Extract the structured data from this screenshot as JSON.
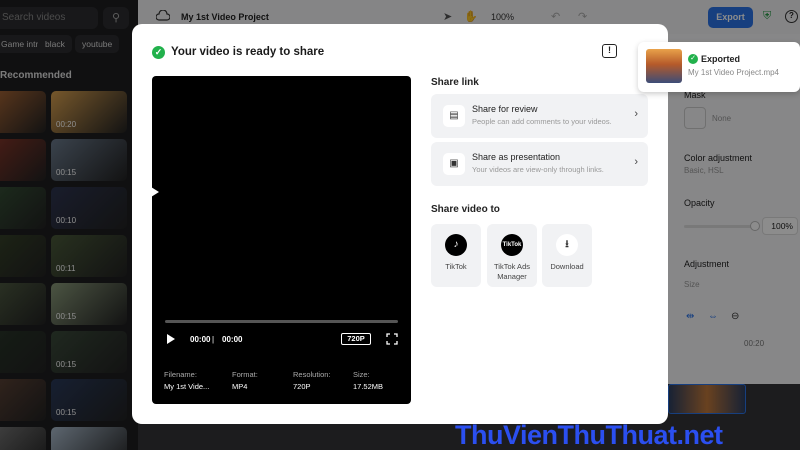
{
  "library": {
    "search_placeholder": "Search videos",
    "chips": [
      "Game intro",
      "black",
      "youtube"
    ],
    "section_title": "Recommended",
    "thumbs": [
      {
        "duration": "",
        "color": "#c8763a"
      },
      {
        "duration": "00:20",
        "color": "#d8a050"
      },
      {
        "duration": "",
        "color": "#9a3a2a"
      },
      {
        "duration": "00:15",
        "color": "#6b7a8c"
      },
      {
        "duration": "",
        "color": "#3a5a3a"
      },
      {
        "duration": "00:10",
        "color": "#2e3550"
      },
      {
        "duration": "",
        "color": "#3b4a2a"
      },
      {
        "duration": "00:11",
        "color": "#4a5a3a"
      },
      {
        "duration": "",
        "color": "#5a6a4a"
      },
      {
        "duration": "00:15",
        "color": "#8a9a7a"
      },
      {
        "duration": "",
        "color": "#2a3a2a"
      },
      {
        "duration": "00:15",
        "color": "#3a4a3a"
      },
      {
        "duration": "",
        "color": "#6a4a3a"
      },
      {
        "duration": "00:15",
        "color": "#2a3a5a"
      },
      {
        "duration": "",
        "color": "#8a8a8a"
      },
      {
        "duration": "",
        "color": "#aabbcc"
      }
    ]
  },
  "topbar": {
    "project_title": "My 1st Video Project",
    "zoom": "100%",
    "export_label": "Export"
  },
  "inspector": {
    "mask_label": "Mask",
    "none_label": "None",
    "color_adj_label": "Color adjustment",
    "color_adj_sub": "Basic, HSL",
    "opacity_label": "Opacity",
    "opacity_value": "100%",
    "adjustment_label": "Adjustment",
    "size_label": "Size"
  },
  "timeline": {
    "time_marker": "00:20"
  },
  "modal": {
    "title": "Your video is ready to share",
    "player": {
      "current_time": "00:00",
      "total_time": "00:00",
      "progress": 0,
      "resolution_badge": "720P"
    },
    "meta": [
      {
        "label": "Filename:",
        "value": "My 1st Vide..."
      },
      {
        "label": "Format:",
        "value": "MP4"
      },
      {
        "label": "Resolution:",
        "value": "720P"
      },
      {
        "label": "Size:",
        "value": "17.52MB"
      }
    ],
    "share_link_heading": "Share link",
    "share_links": [
      {
        "title": "Share for review",
        "desc": "People can add comments to your videos.",
        "icon": "comment-icon"
      },
      {
        "title": "Share as presentation",
        "desc": "Your videos are view-only through links.",
        "icon": "presentation-icon"
      }
    ],
    "share_to_heading": "Share video to",
    "share_targets": [
      {
        "label": "TikTok",
        "icon": "tiktok-icon"
      },
      {
        "label": "TikTok Ads Manager",
        "icon": "tiktok-ads-icon"
      },
      {
        "label": "Download",
        "icon": "download-icon"
      }
    ]
  },
  "toast": {
    "title": "Exported",
    "filename": "My 1st Video Project.mp4"
  },
  "watermark": "ThuVienThuThuat.net"
}
